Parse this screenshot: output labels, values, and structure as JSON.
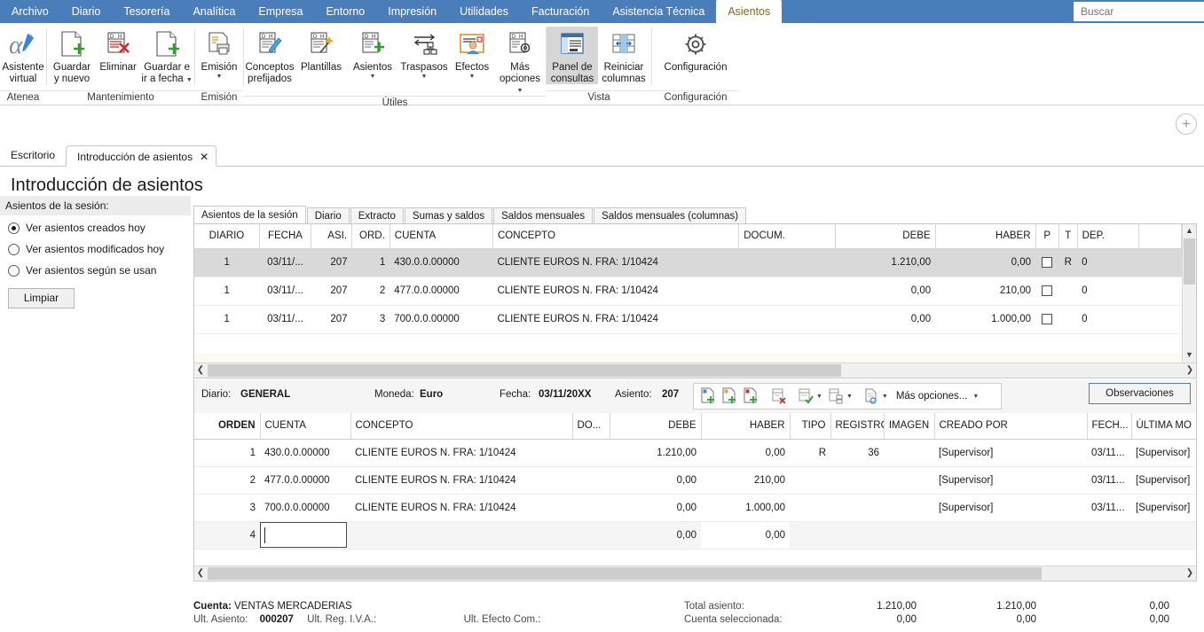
{
  "ribbon": {
    "tabs": [
      {
        "label": "Archivo",
        "active": false
      },
      {
        "label": "Diario",
        "active": false
      },
      {
        "label": "Tesorería",
        "active": false
      },
      {
        "label": "Analítica",
        "active": false
      },
      {
        "label": "Empresa",
        "active": false
      },
      {
        "label": "Entorno",
        "active": false
      },
      {
        "label": "Impresión",
        "active": false
      },
      {
        "label": "Utilidades",
        "active": false
      },
      {
        "label": "Facturación",
        "active": false
      },
      {
        "label": "Asistencia Técnica",
        "active": false
      },
      {
        "label": "Asientos",
        "active": true
      }
    ],
    "search_placeholder": "Buscar",
    "groups": [
      {
        "label": "Atenea",
        "buttons": [
          {
            "icon": "alpha-pen-icon",
            "line1": "Asistente",
            "line2": "virtual",
            "caret": false,
            "selected": false
          }
        ]
      },
      {
        "label": "Mantenimiento",
        "buttons": [
          {
            "icon": "document-plus-icon",
            "line1": "Guardar",
            "line2": "y nuevo",
            "caret": false,
            "selected": false
          },
          {
            "icon": "document-delete-icon",
            "line1": "Eliminar",
            "line2": "",
            "caret": false,
            "selected": false
          },
          {
            "icon": "document-plus-icon",
            "line1": "Guardar e",
            "line2": "ir a fecha",
            "caret": true,
            "selected": false
          }
        ]
      },
      {
        "label": "Emisión",
        "buttons": [
          {
            "icon": "print-document-icon",
            "line1": "Emisión",
            "line2": "",
            "caret": true,
            "selected": false
          }
        ]
      },
      {
        "label": "Útiles",
        "buttons": [
          {
            "icon": "document-pencil-icon",
            "line1": "Conceptos",
            "line2": "prefijados",
            "caret": false,
            "selected": false
          },
          {
            "icon": "document-wand-icon",
            "line1": "Plantillas",
            "line2": "",
            "caret": false,
            "selected": false
          },
          {
            "icon": "document-add-icon",
            "line1": "Asientos",
            "line2": "",
            "caret": true,
            "selected": false
          },
          {
            "icon": "transfer-arrows-icon",
            "line1": "Traspasos",
            "line2": "",
            "caret": true,
            "selected": false
          },
          {
            "icon": "effects-person-icon",
            "line1": "Efectos",
            "line2": "",
            "caret": true,
            "selected": false
          },
          {
            "icon": "document-gear-icon",
            "line1": "Más",
            "line2": "opciones",
            "caret": true,
            "selected": false
          }
        ]
      },
      {
        "label": "Vista",
        "buttons": [
          {
            "icon": "query-panel-icon",
            "line1": "Panel de",
            "line2": "consultas",
            "caret": false,
            "selected": true
          },
          {
            "icon": "reset-columns-icon",
            "line1": "Reiniciar",
            "line2": "columnas",
            "caret": false,
            "selected": false
          }
        ]
      },
      {
        "label": "Configuración",
        "buttons": [
          {
            "icon": "gear-icon",
            "line1": "Configuración",
            "line2": "",
            "caret": false,
            "selected": false
          }
        ]
      }
    ]
  },
  "doctabs": [
    {
      "label": "Escritorio",
      "active": false,
      "closable": false
    },
    {
      "label": "Introducción de asientos",
      "active": true,
      "closable": true
    }
  ],
  "page_title": "Introducción de asientos",
  "left_panel": {
    "header": "Asientos de la sesión:",
    "options": [
      {
        "label": "Ver asientos creados hoy",
        "selected": true
      },
      {
        "label": "Ver asientos modificados hoy",
        "selected": false
      },
      {
        "label": "Ver asientos según se usan",
        "selected": false
      }
    ],
    "clear_button": "Limpiar"
  },
  "grid_tabs": [
    {
      "label": "Asientos de la sesión",
      "active": true
    },
    {
      "label": "Diario",
      "active": false
    },
    {
      "label": "Extracto",
      "active": false
    },
    {
      "label": "Sumas y saldos",
      "active": false
    },
    {
      "label": "Saldos mensuales",
      "active": false
    },
    {
      "label": "Saldos mensuales (columnas)",
      "active": false
    }
  ],
  "top_grid": {
    "columns": [
      "DIARIO",
      "FECHA",
      "ASI.",
      "ORD.",
      "CUENTA",
      "CONCEPTO",
      "DOCUM.",
      "DEBE",
      "HABER",
      "P",
      "T",
      "DEP.",
      ""
    ],
    "rows": [
      {
        "selected": true,
        "diario": "1",
        "fecha": "03/11/...",
        "asi": "207",
        "ord": "1",
        "cuenta": "430.0.0.00000",
        "concepto": "CLIENTE EUROS N. FRA:  1/10424",
        "docum": "",
        "debe": "1.210,00",
        "haber": "0,00",
        "p": false,
        "t": "R",
        "dep": "0"
      },
      {
        "selected": false,
        "diario": "1",
        "fecha": "03/11/...",
        "asi": "207",
        "ord": "2",
        "cuenta": "477.0.0.00000",
        "concepto": "CLIENTE EUROS N. FRA:  1/10424",
        "docum": "",
        "debe": "0,00",
        "haber": "210,00",
        "p": false,
        "t": "",
        "dep": "0"
      },
      {
        "selected": false,
        "diario": "1",
        "fecha": "03/11/...",
        "asi": "207",
        "ord": "3",
        "cuenta": "700.0.0.00000",
        "concepto": "CLIENTE EUROS N. FRA:  1/10424",
        "docum": "",
        "debe": "0,00",
        "haber": "1.000,00",
        "p": false,
        "t": "",
        "dep": "0"
      }
    ]
  },
  "midbar": {
    "diario_label": "Diario:",
    "diario_value": "GENERAL",
    "moneda_label": "Moneda:",
    "moneda_value": "Euro",
    "fecha_label": "Fecha:",
    "fecha_value": "03/11/20XX",
    "asiento_label": "Asiento:",
    "asiento_value": "207",
    "tools": [
      {
        "icon": "new-document-blue-icon"
      },
      {
        "icon": "new-document-orange-icon"
      },
      {
        "icon": "new-document-red-icon"
      },
      {
        "icon": "delete-row-icon"
      },
      {
        "icon": "check-grid-icon",
        "caret": true
      },
      {
        "icon": "split-grid-icon",
        "caret": true
      },
      {
        "icon": "preview-document-icon",
        "caret": true
      }
    ],
    "more_options": "Más opciones...",
    "observaciones": "Observaciones"
  },
  "bottom_grid": {
    "columns": [
      "ORDEN",
      "CUENTA",
      "CONCEPTO",
      "DO...",
      "DEBE",
      "HABER",
      "TIPO",
      "REGISTRO",
      "IMAGEN",
      "CREADO POR",
      "FECH...",
      "ÚLTIMA MO"
    ],
    "rows": [
      {
        "orden": "1",
        "cuenta": "430.0.0.00000",
        "concepto": "CLIENTE EUROS N. FRA:  1/10424",
        "do": "",
        "debe": "1.210,00",
        "haber": "0,00",
        "tipo": "R",
        "registro": "36",
        "imagen": "",
        "creado_por": "[Supervisor]",
        "fecha": "03/11...",
        "ultima_mod": "[Supervisor]"
      },
      {
        "orden": "2",
        "cuenta": "477.0.0.00000",
        "concepto": "CLIENTE EUROS N. FRA:  1/10424",
        "do": "",
        "debe": "0,00",
        "haber": "210,00",
        "tipo": "",
        "registro": "",
        "imagen": "",
        "creado_por": "[Supervisor]",
        "fecha": "03/11...",
        "ultima_mod": "[Supervisor]"
      },
      {
        "orden": "3",
        "cuenta": "700.0.0.00000",
        "concepto": "CLIENTE EUROS N. FRA:  1/10424",
        "do": "",
        "debe": "0,00",
        "haber": "1.000,00",
        "tipo": "",
        "registro": "",
        "imagen": "",
        "creado_por": "[Supervisor]",
        "fecha": "03/11...",
        "ultima_mod": "[Supervisor]"
      }
    ],
    "edit_row": {
      "orden": "4",
      "cuenta_value": "",
      "debe": "0,00",
      "haber": "0,00"
    }
  },
  "status": {
    "cuenta_label": "Cuenta:",
    "cuenta_value": "VENTAS MERCADERIAS",
    "ult_asiento_label": "Ult. Asiento:",
    "ult_asiento_value": "000207",
    "ult_reg_iva_label": "Ult. Reg. I.V.A.:",
    "ult_efecto_label": "Ult. Efecto Com.:",
    "total_asiento_label": "Total asiento:",
    "total_asiento_debe": "1.210,00",
    "total_asiento_haber": "1.210,00",
    "total_asiento_dif": "0,00",
    "cuenta_sel_label": "Cuenta seleccionada:",
    "cuenta_sel_debe": "0,00",
    "cuenta_sel_haber": "0,00",
    "cuenta_sel_dif": "0,00"
  }
}
